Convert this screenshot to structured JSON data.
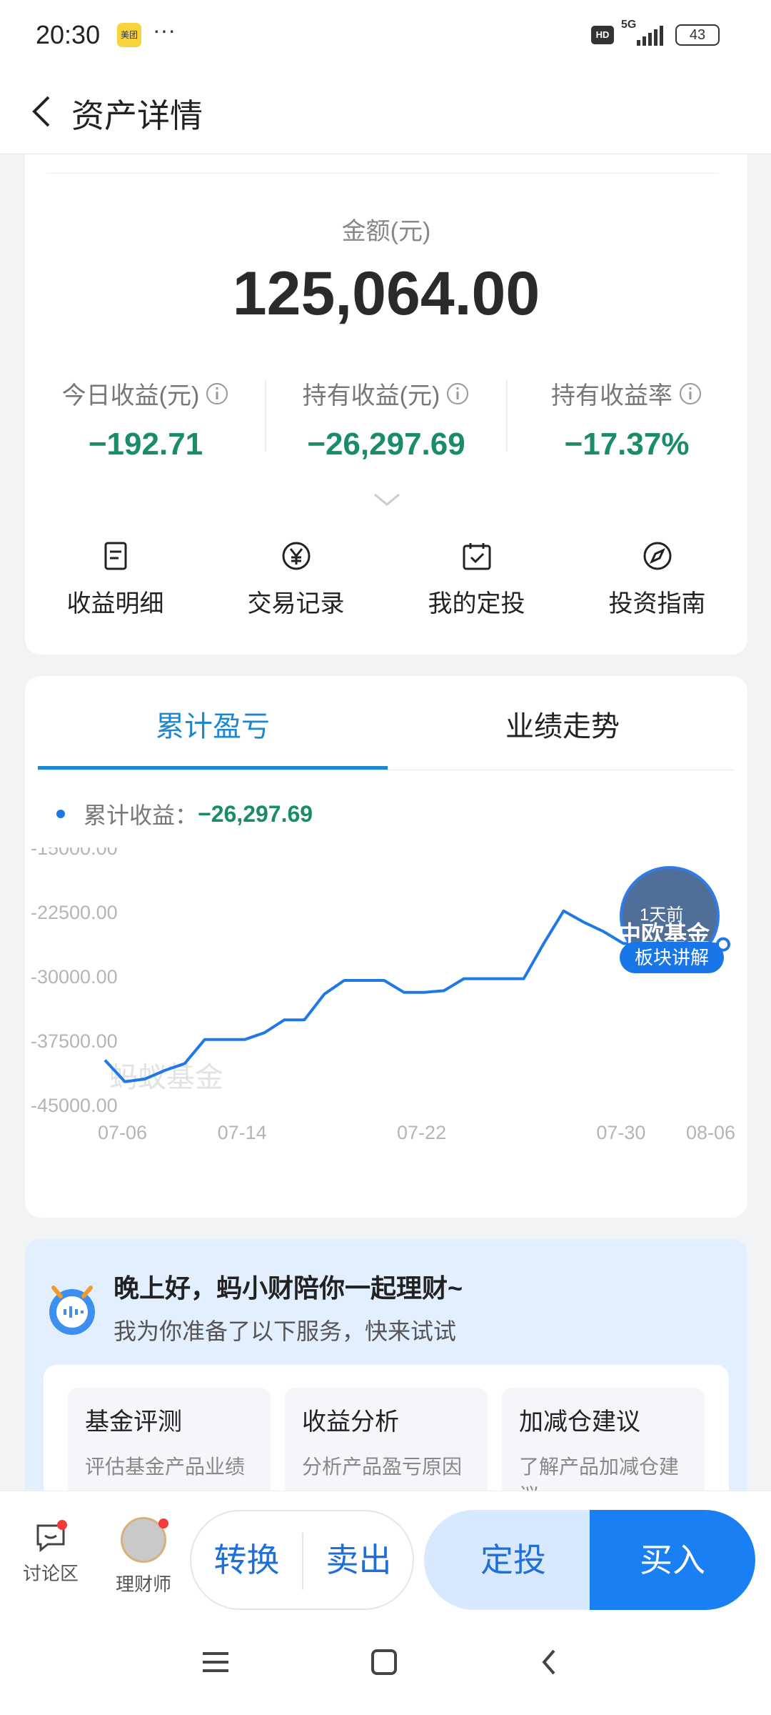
{
  "status_bar": {
    "time": "20:30",
    "app_badge": "美团",
    "more": "···",
    "hd": "HD",
    "network": "5G",
    "battery": "43"
  },
  "nav": {
    "title": "资产详情"
  },
  "asset": {
    "amount_label": "金额(元)",
    "amount_value": "125,064.00",
    "stats": [
      {
        "label": "今日收益(元)",
        "value": "−192.71"
      },
      {
        "label": "持有收益(元)",
        "value": "−26,297.69"
      },
      {
        "label": "持有收益率",
        "value": "−17.37%"
      }
    ],
    "quick_actions": [
      {
        "label": "收益明细",
        "icon": "document-icon"
      },
      {
        "label": "交易记录",
        "icon": "yen-icon"
      },
      {
        "label": "我的定投",
        "icon": "calendar-check-icon"
      },
      {
        "label": "投资指南",
        "icon": "compass-icon"
      }
    ]
  },
  "chart_card": {
    "tabs": [
      "累计盈亏",
      "业绩走势"
    ],
    "active_tab": 0,
    "legend_label": "累计收益：",
    "legend_value": "−26,297.69",
    "watermark": "蚂蚁基金",
    "badge": {
      "time": "1天前",
      "brand": "中欧基金",
      "action": "板块讲解"
    }
  },
  "chart_data": {
    "type": "line",
    "series": [
      {
        "name": "累计收益",
        "color": "#1e78e6",
        "values": [
          -39800,
          -42300,
          -42000,
          -41000,
          -40200,
          -37400,
          -37400,
          -37400,
          -36600,
          -35100,
          -35100,
          -32100,
          -30500,
          -30500,
          -30500,
          -31900,
          -31900,
          -31700,
          -30300,
          -30300,
          -30300,
          -30300,
          -26200,
          -22400,
          -23700,
          -24800,
          -26200,
          -26200,
          -26300,
          -26800,
          -26200,
          -26300
        ]
      }
    ],
    "x_tick_labels": [
      "07-06",
      "07-14",
      "07-22",
      "07-30",
      "08-06"
    ],
    "y_tick_labels": [
      "-15000.00",
      "-22500.00",
      "-30000.00",
      "-37500.00",
      "-45000.00"
    ],
    "ylim": [
      -45000,
      -15000
    ],
    "grid": false
  },
  "assistant": {
    "greeting": "晚上好，蚂小财陪你一起理财~",
    "subtitle": "我为你准备了以下服务，快来试试",
    "services": [
      {
        "title": "基金评测",
        "desc": "评估基金产品业绩"
      },
      {
        "title": "收益分析",
        "desc": "分析产品盈亏原因"
      },
      {
        "title": "加减仓建议",
        "desc": "了解产品加减仓建议"
      }
    ]
  },
  "action_bar": {
    "discuss": "讨论区",
    "advisor": "理财师",
    "convert": "转换",
    "sell": "卖出",
    "auto_invest": "定投",
    "buy": "买入"
  }
}
